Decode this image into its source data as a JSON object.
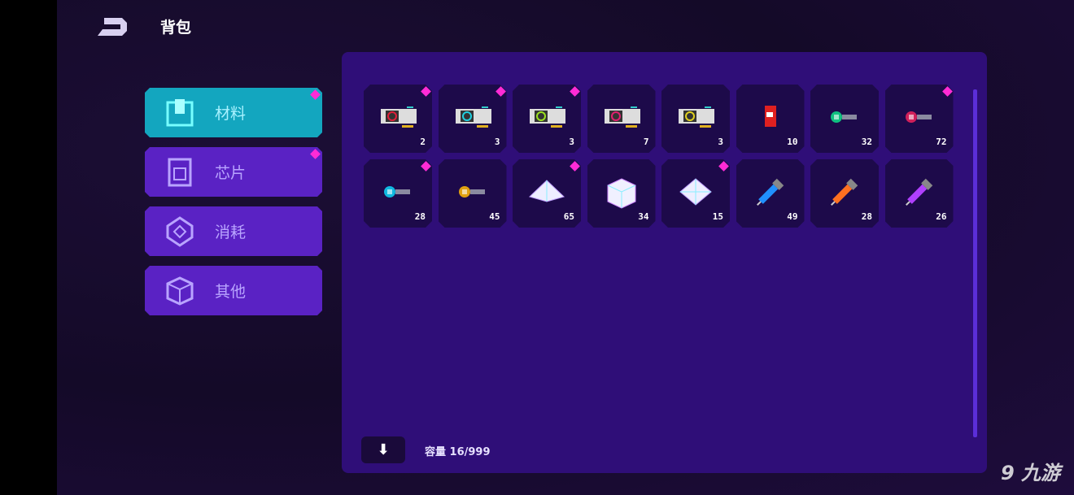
{
  "header": {
    "title": "背包",
    "back_icon": "back-arrow-icon"
  },
  "tabs": [
    {
      "label": "材料",
      "icon": "materials-icon",
      "active": true,
      "new": true
    },
    {
      "label": "芯片",
      "icon": "chip-icon",
      "active": false,
      "new": true
    },
    {
      "label": "消耗",
      "icon": "consumable-icon",
      "active": false,
      "new": false
    },
    {
      "label": "其他",
      "icon": "box-icon",
      "active": false,
      "new": false
    }
  ],
  "items": [
    {
      "icon": "gpu-red-icon",
      "color": "#e0203a",
      "count": "2",
      "new": true
    },
    {
      "icon": "gpu-cyan-icon",
      "color": "#20d0e0",
      "count": "3",
      "new": true
    },
    {
      "icon": "gpu-green-icon",
      "color": "#9be020",
      "count": "3",
      "new": true
    },
    {
      "icon": "gpu-pink-icon",
      "color": "#e02070",
      "count": "7",
      "new": false
    },
    {
      "icon": "gpu-yellow-icon",
      "color": "#e0d020",
      "count": "3",
      "new": false
    },
    {
      "icon": "red-can-icon",
      "color": "#e02020",
      "count": "10",
      "new": false
    },
    {
      "icon": "green-key-icon",
      "color": "#10c080",
      "count": "32",
      "new": false
    },
    {
      "icon": "red-key-icon",
      "color": "#d0205a",
      "count": "72",
      "new": true
    },
    {
      "icon": "cyan-key-icon",
      "color": "#10b8e0",
      "count": "28",
      "new": true
    },
    {
      "icon": "orange-key-icon",
      "color": "#e0a010",
      "count": "45",
      "new": false
    },
    {
      "icon": "pyramid-crystal-icon",
      "color": "#e8e0ff",
      "count": "65",
      "new": true
    },
    {
      "icon": "cube-crystal-icon",
      "color": "#e8e0ff",
      "count": "34",
      "new": false
    },
    {
      "icon": "diamond-crystal-icon",
      "color": "#e8e0ff",
      "count": "15",
      "new": true
    },
    {
      "icon": "blue-syringe-icon",
      "color": "#2090ff",
      "count": "49",
      "new": false
    },
    {
      "icon": "orange-syringe-icon",
      "color": "#ff7020",
      "count": "28",
      "new": false
    },
    {
      "icon": "purple-syringe-icon",
      "color": "#b040ff",
      "count": "26",
      "new": false
    }
  ],
  "footer": {
    "sort_label": "⬇",
    "capacity": "容量 16/999"
  },
  "watermark": "九游",
  "colors": {
    "panel": "#2f0e78",
    "tab_active": "#13a6bf",
    "tab": "#5a22c4",
    "badge": "#ff2bd6"
  }
}
